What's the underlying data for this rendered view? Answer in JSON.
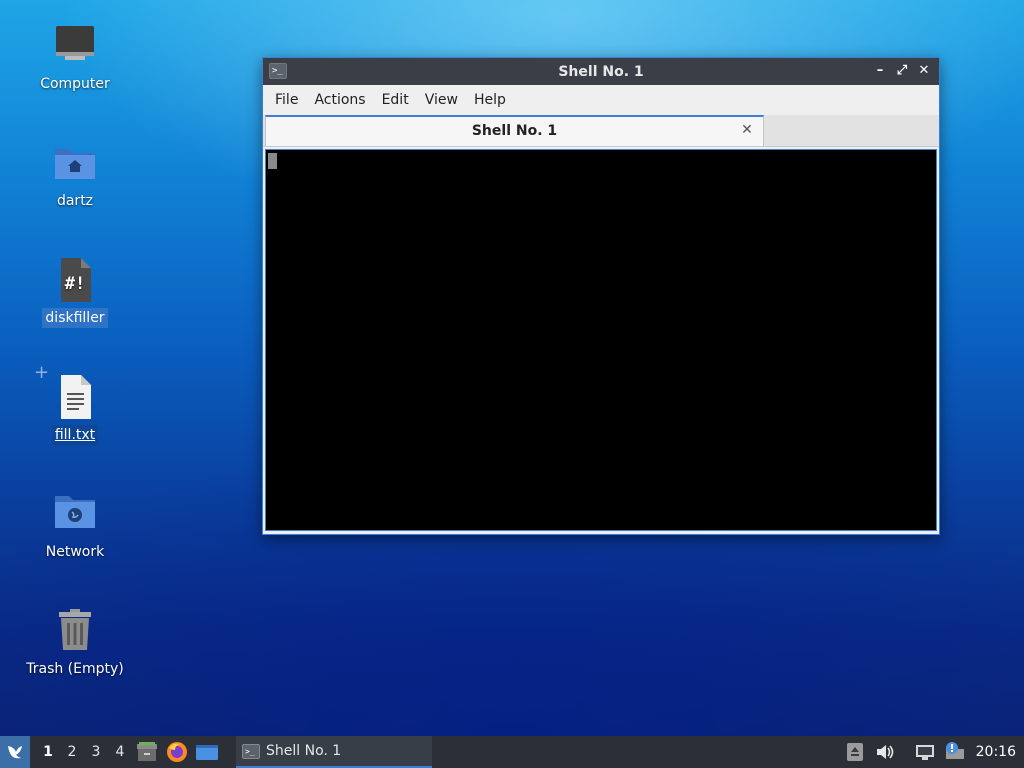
{
  "desktop": {
    "icons": [
      {
        "label": "Computer"
      },
      {
        "label": "dartz"
      },
      {
        "label": "diskfiller",
        "glyph": "#!"
      },
      {
        "label": "fill.txt"
      },
      {
        "label": "Network"
      },
      {
        "label": "Trash (Empty)"
      }
    ]
  },
  "window": {
    "title": "Shell No. 1",
    "controls": {
      "minimize": "–",
      "maximize": "⤢",
      "close": "✕"
    },
    "menu": [
      "File",
      "Actions",
      "Edit",
      "View",
      "Help"
    ],
    "tab": {
      "label": "Shell No. 1",
      "close": "✕"
    }
  },
  "taskbar": {
    "workspaces": [
      "1",
      "2",
      "3",
      "4"
    ],
    "active_workspace": "1",
    "task": {
      "label": "Shell No. 1"
    },
    "clock": "20:16"
  },
  "colors": {
    "accent": "#3d7fd6",
    "titlebar": "#3a3f47",
    "taskbar": "#2b3038",
    "terminal_bg": "#000000"
  }
}
